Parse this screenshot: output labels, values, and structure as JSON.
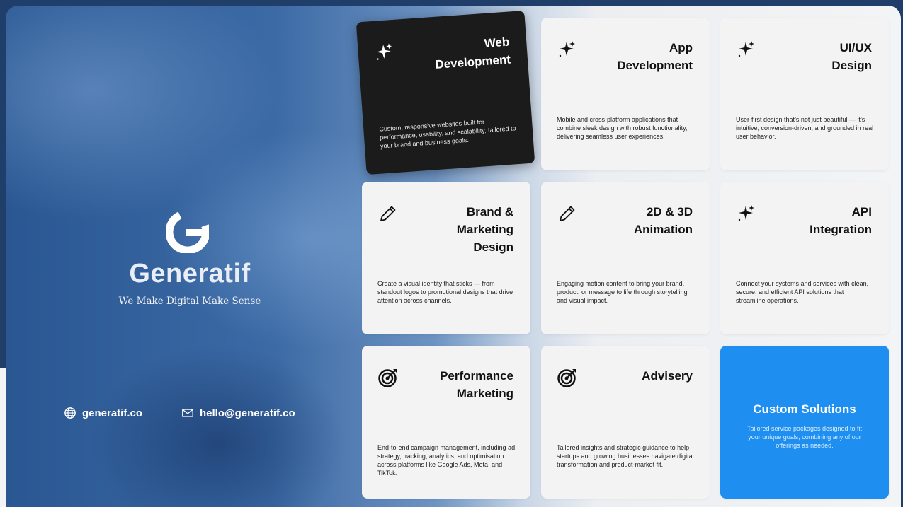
{
  "brand": {
    "name": "Generatif",
    "tagline": "We Make Digital Make Sense",
    "website": "generatif.co",
    "email": "hello@generatif.co"
  },
  "services": [
    {
      "title_lines": [
        "Web",
        "Development"
      ],
      "description": "Custom, responsive websites built for performance, usability, and scalability, tailored to your brand and business goals.",
      "icon": "sparkle-icon"
    },
    {
      "title_lines": [
        "App",
        "Development"
      ],
      "description": "Mobile and cross-platform applications that combine sleek design with robust functionality, delivering seamless user experiences.",
      "icon": "sparkle-icon"
    },
    {
      "title_lines": [
        "UI/UX",
        "Design"
      ],
      "description": "User-first design that’s not just beautiful — it’s intuitive, conversion-driven, and grounded in real user behavior.",
      "icon": "sparkle-icon"
    },
    {
      "title_lines": [
        "Brand &",
        "Marketing",
        "Design"
      ],
      "description": "Create a visual identity that sticks — from standout logos to promotional designs that drive attention across channels.",
      "icon": "pencil-icon"
    },
    {
      "title_lines": [
        "2D & 3D",
        "Animation"
      ],
      "description": "Engaging motion content to bring your brand, product, or message to life through storytelling and visual impact.",
      "icon": "pencil-icon"
    },
    {
      "title_lines": [
        "API",
        "Integration"
      ],
      "description": "Connect your systems and services with clean, secure, and efficient API solutions that streamline operations.",
      "icon": "sparkle-icon"
    },
    {
      "title_lines": [
        "Performance",
        "Marketing"
      ],
      "description": "End-to-end campaign management, including ad strategy, tracking, analytics, and optimisation across platforms like Google Ads, Meta, and TikTok.",
      "icon": "target-icon"
    },
    {
      "title_lines": [
        "Advisery"
      ],
      "description": "Tailored insights and strategic guidance to help startups and growing businesses navigate digital transformation and product-market fit.",
      "icon": "target-icon"
    },
    {
      "title": "Custom Solutions",
      "description": "Tailored service packages designed to fit your unique goals, combining any of our offerings as needed."
    }
  ],
  "colors": {
    "dark_card": "#1b1b1b",
    "accent_card": "#1e8ff0",
    "light_card": "#f3f3f4",
    "background_blue": "#2a5792"
  }
}
